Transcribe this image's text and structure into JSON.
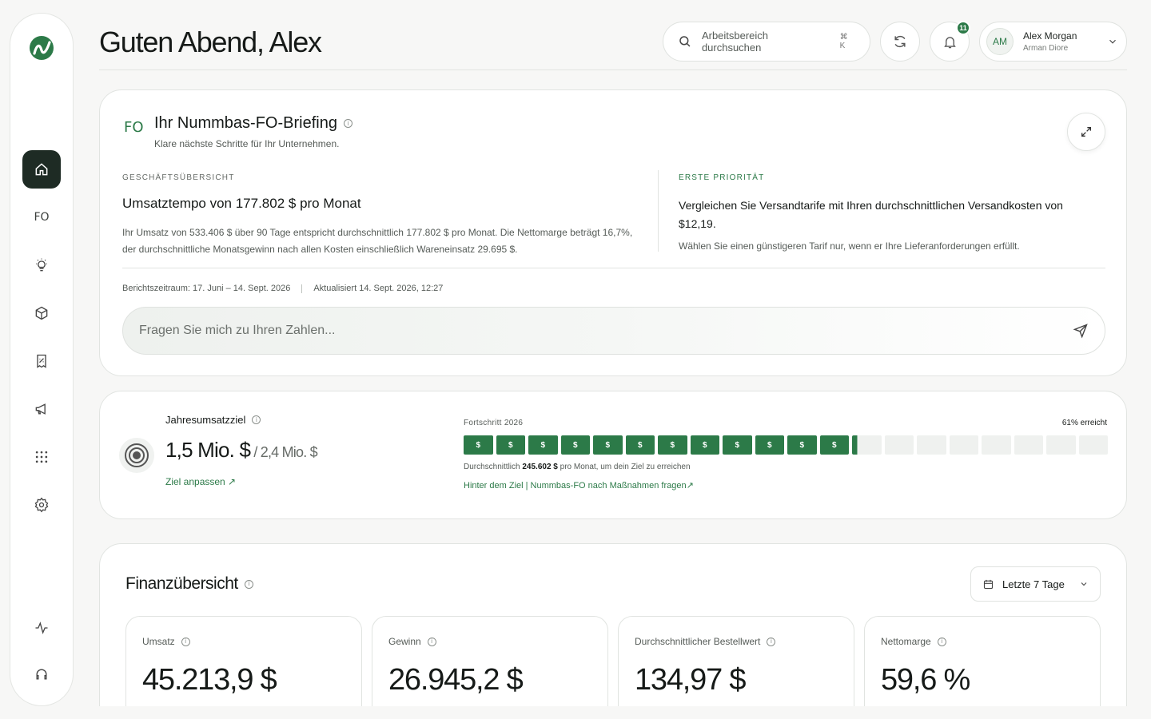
{
  "header": {
    "greeting": "Guten Abend, Alex",
    "search_placeholder": "Arbeitsbereich durchsuchen",
    "search_shortcut": "⌘ K",
    "notification_count": "11",
    "user": {
      "initials": "AM",
      "name": "Alex Morgan",
      "role": "Arman Diore"
    }
  },
  "sidebar": {
    "items": [
      {
        "name": "home",
        "icon": "home-icon"
      },
      {
        "name": "fo",
        "icon": "fo-icon",
        "label": "FO"
      },
      {
        "name": "insights",
        "icon": "lightbulb-icon"
      },
      {
        "name": "products",
        "icon": "box-icon"
      },
      {
        "name": "reports",
        "icon": "receipt-icon"
      },
      {
        "name": "marketing",
        "icon": "megaphone-icon"
      },
      {
        "name": "apps",
        "icon": "grid-icon"
      },
      {
        "name": "settings",
        "icon": "gear-icon"
      },
      {
        "name": "activity",
        "icon": "pulse-icon"
      },
      {
        "name": "support",
        "icon": "headset-icon"
      }
    ]
  },
  "briefing": {
    "logo_text": "FO",
    "title": "Ihr Nummbas-FO-Briefing",
    "subtitle": "Klare nächste Schritte für Ihr Unternehmen.",
    "left": {
      "eyebrow": "GESCHÄFTSÜBERSICHT",
      "heading": "Umsatztempo von 177.802 $ pro Monat",
      "text": "Ihr Umsatz von 533.406 $ über 90 Tage entspricht durchschnittlich 177.802 $ pro Monat. Die Nettomarge beträgt 16,7%, der durchschnittliche Monatsgewinn nach allen Kosten einschließlich Wareneinsatz 29.695 $."
    },
    "right": {
      "eyebrow": "ERSTE PRIORITÄT",
      "heading": "Vergleichen Sie Versandtarife mit Ihren durchschnittlichen Versandkosten von $12,19.",
      "text": "Wählen Sie einen günstigeren Tarif nur, wenn er Ihre Lieferanforderungen erfüllt."
    },
    "period": "Berichtszeitraum: 17. Juni – 14. Sept. 2026",
    "updated": "Aktualisiert 14. Sept. 2026, 12:27",
    "ask_placeholder": "Fragen Sie mich zu Ihren Zahlen..."
  },
  "goal": {
    "title": "Jahresumsatzziel",
    "value": "1,5 Mio. $",
    "target": " / 2,4 Mio. $",
    "adjust_link": "Ziel anpassen ↗",
    "progress_label": "Fortschritt 2026",
    "progress_text": "61% erreicht",
    "progress_fraction": 0.61,
    "segments_total": 20,
    "segments_filled": 12,
    "segment_symbol": "$",
    "avg_prefix": "Durchschnittlich",
    "avg_value": "245.602 $",
    "avg_suffix": "pro Monat, um dein Ziel zu erreichen",
    "behind_link": "Hinter dem Ziel | Nummbas-FO nach Maßnahmen fragen↗"
  },
  "finance": {
    "title": "Finanzübersicht",
    "range": "Letzte 7 Tage",
    "kpis": [
      {
        "label": "Umsatz",
        "value": "45.213,9 $"
      },
      {
        "label": "Gewinn",
        "value": "26.945,2 $"
      },
      {
        "label": "Durchschnittlicher Bestellwert",
        "value": "134,97 $"
      },
      {
        "label": "Nettomarge",
        "value": "59,6 %"
      }
    ]
  },
  "colors": {
    "accent": "#2c7a48",
    "nav_active": "#1e2b24"
  }
}
